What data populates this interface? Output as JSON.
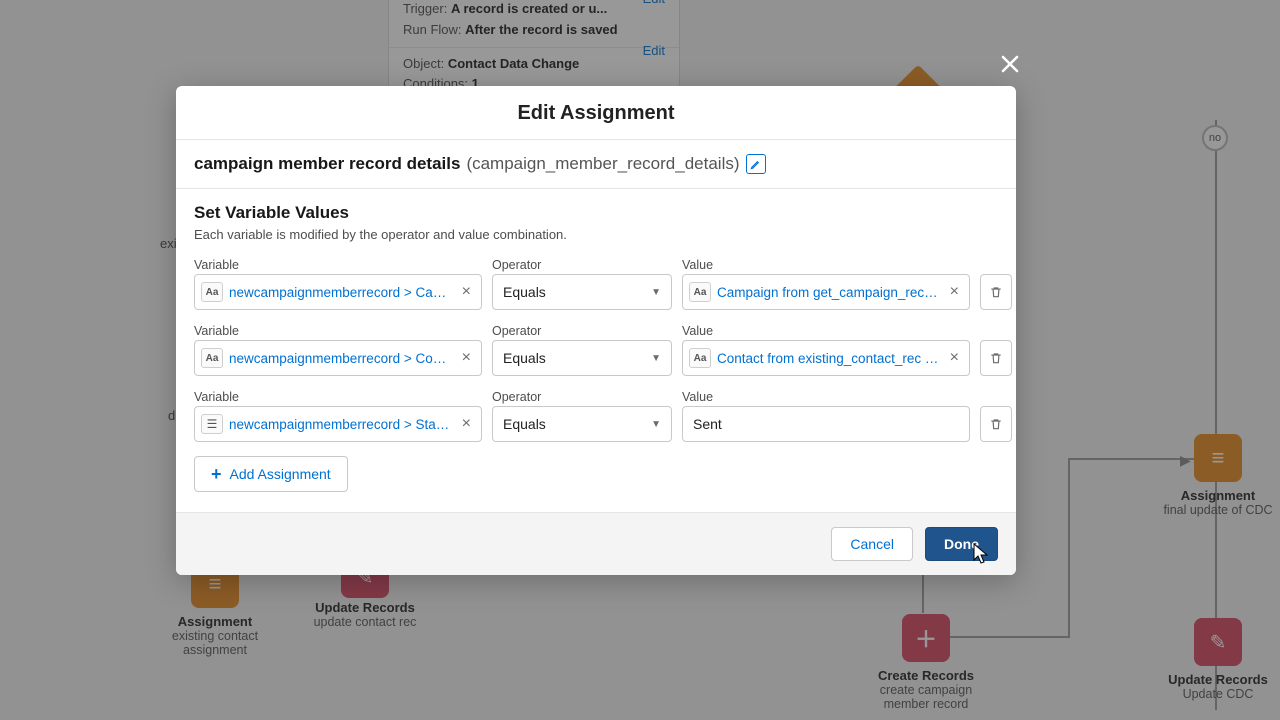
{
  "background": {
    "trigger_box": {
      "trigger_label": "Trigger:",
      "trigger_value": "A record is created or u...",
      "run_label": "Run Flow:",
      "run_value": "After the record is saved",
      "object_label": "Object:",
      "object_value": "Contact Data Change",
      "conditions_label": "Conditions:",
      "conditions_value": "1",
      "edit": "Edit"
    },
    "nodes": {
      "assignment1": {
        "title": "Assignment",
        "sub1": "existing contact",
        "sub2": "assignment"
      },
      "update_contact": {
        "title": "Update Records",
        "sub": "update contact rec"
      },
      "create_records": {
        "title": "Create Records",
        "sub1": "create campaign",
        "sub2": "member record"
      },
      "assignment2": {
        "title": "Assignment",
        "sub": "final update of CDC"
      },
      "update_cdc": {
        "title": "Update Records",
        "sub": "Update CDC"
      }
    },
    "side_text": {
      "exi": "exi",
      "d": "d"
    },
    "decision": {
      "no": "no"
    }
  },
  "modal": {
    "title": "Edit Assignment",
    "display_name": "campaign member record details",
    "api_name": "(campaign_member_record_details)",
    "section_title": "Set Variable Values",
    "section_sub": "Each variable is modified by the operator and value combination.",
    "labels": {
      "variable": "Variable",
      "operator": "Operator",
      "value": "Value"
    },
    "rows": [
      {
        "var_icon": "Aa",
        "var_text": "newcampaignmemberrecord > Cam...",
        "op": "Equals",
        "val_icon": "Aa",
        "val_text": "Campaign from get_campaign_recor...",
        "val_is_pill": true
      },
      {
        "var_icon": "Aa",
        "var_text": "newcampaignmemberrecord > Cont...",
        "op": "Equals",
        "val_icon": "Aa",
        "val_text": "Contact from existing_contact_rec > ...",
        "val_is_pill": true
      },
      {
        "var_icon": "list",
        "var_text": "newcampaignmemberrecord > Status",
        "op": "Equals",
        "val_plain": "Sent",
        "val_is_pill": false
      }
    ],
    "add_label": "Add Assignment",
    "cancel": "Cancel",
    "done": "Done"
  }
}
